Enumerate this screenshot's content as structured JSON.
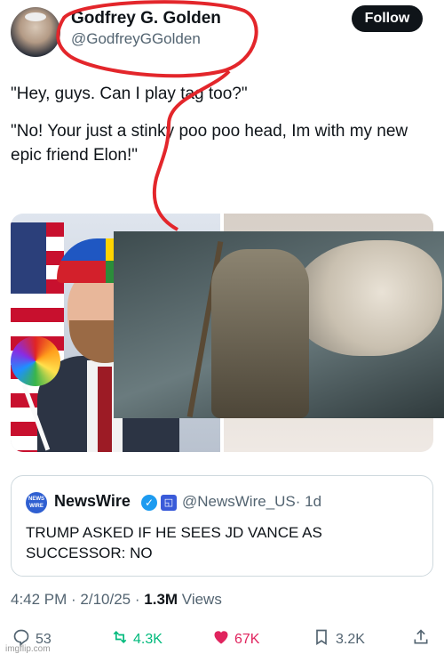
{
  "author": {
    "display_name": "Godfrey G. Golden",
    "handle": "@GodfreyGGolden",
    "follow_label": "Follow"
  },
  "tweet": {
    "lines": [
      "\"Hey, guys. Can I play tag too?\"",
      "\"No! Your just a stinky poo poo head, Im with my new epic friend Elon!\""
    ]
  },
  "quote": {
    "avatar_text": "NEWS WIRE",
    "name": "NewsWire",
    "handle": "@NewsWire_US",
    "time": "· 1d",
    "text": "TRUMP ASKED IF HE SEES JD VANCE AS SUCCESSOR: NO"
  },
  "meta": {
    "time": "4:42 PM",
    "date": "2/10/25",
    "views_count": "1.3M",
    "views_label": "Views"
  },
  "actions": {
    "replies": "53",
    "reposts": "4.3K",
    "likes": "67K",
    "bookmarks": "3.2K"
  },
  "watermark": "imgflip.com",
  "colors": {
    "accent_red": "#e0245e",
    "repost_green": "#00ba7c",
    "verified_blue": "#1d9bf0",
    "scribble_red": "#e3262b"
  },
  "icons": [
    "reply-icon",
    "repost-icon",
    "like-icon",
    "bookmark-icon",
    "share-icon",
    "verified-badge-icon"
  ]
}
